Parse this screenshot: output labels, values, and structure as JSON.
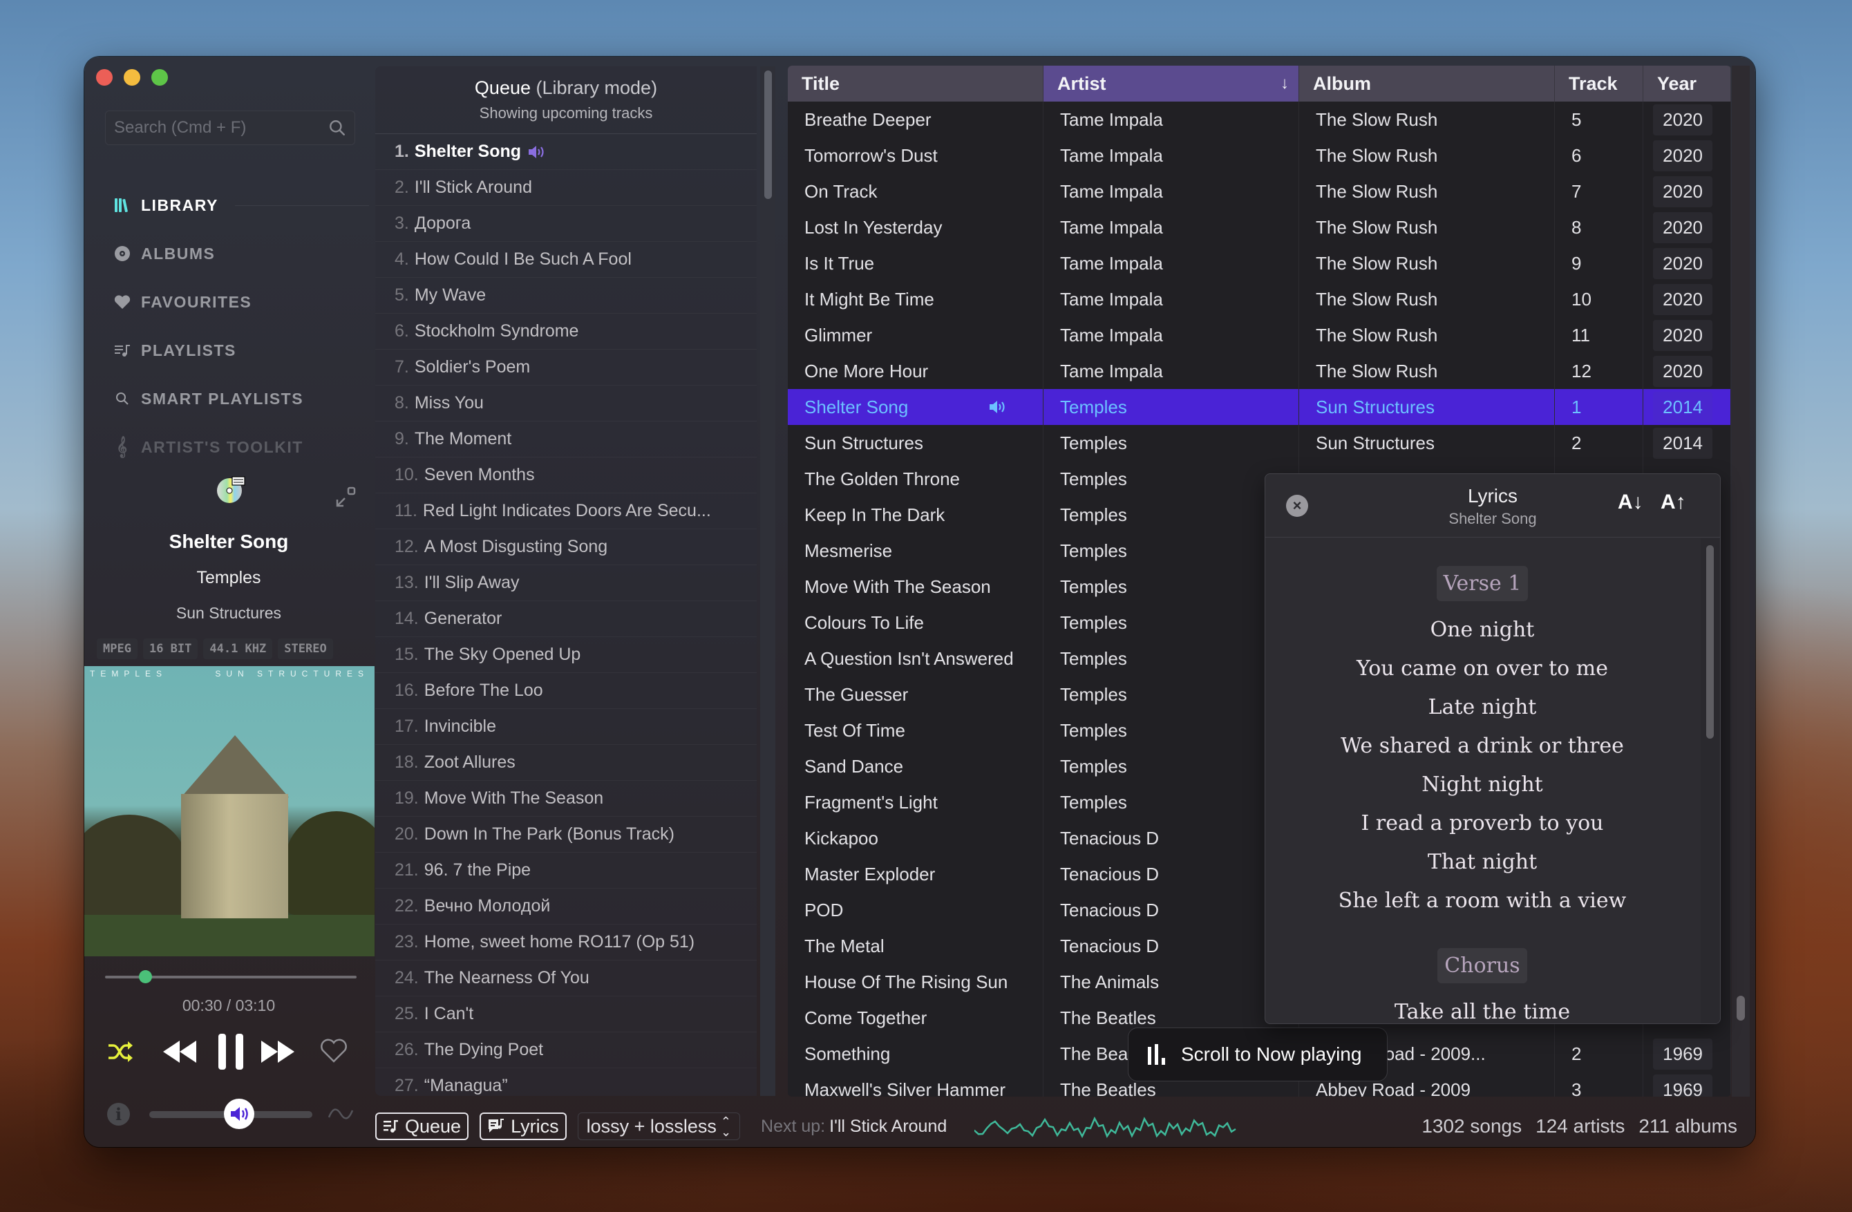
{
  "window": {
    "traffic_lights": [
      "close",
      "minimize",
      "zoom"
    ]
  },
  "sidebar": {
    "search_placeholder": "Search (Cmd + F)",
    "nav": [
      {
        "label": "LIBRARY",
        "icon": "library-icon",
        "state": "active"
      },
      {
        "label": "ALBUMS",
        "icon": "album-disc-icon",
        "state": "normal"
      },
      {
        "label": "FAVOURITES",
        "icon": "heart-icon",
        "state": "normal"
      },
      {
        "label": "PLAYLISTS",
        "icon": "playlist-icon",
        "state": "normal"
      },
      {
        "label": "SMART PLAYLISTS",
        "icon": "search-icon",
        "state": "normal"
      },
      {
        "label": "ARTIST'S TOOLKIT",
        "icon": "treble-clef-icon",
        "state": "dim"
      }
    ]
  },
  "now_playing": {
    "title": "Shelter Song",
    "artist": "Temples",
    "album": "Sun Structures",
    "badges": [
      "MPEG",
      "16 BIT",
      "44.1 KHZ",
      "STEREO"
    ],
    "cover_text_left": "TEMPLES",
    "cover_text_right": "SUN STRUCTURES",
    "elapsed": "00:30",
    "duration": "03:10",
    "time_display": "00:30 / 03:10",
    "progress_fraction": 0.158,
    "volume_fraction": 0.55,
    "shuffle_on": true,
    "is_playing": true
  },
  "queue": {
    "title": "Queue",
    "mode": "(Library mode)",
    "subtitle": "Showing upcoming tracks",
    "items": [
      {
        "n": "1.",
        "title": "Shelter Song",
        "current": true
      },
      {
        "n": "2.",
        "title": "I'll Stick Around"
      },
      {
        "n": "3.",
        "title": "Дорога"
      },
      {
        "n": "4.",
        "title": "How Could I Be Such A Fool"
      },
      {
        "n": "5.",
        "title": "My Wave"
      },
      {
        "n": "6.",
        "title": "Stockholm Syndrome"
      },
      {
        "n": "7.",
        "title": "Soldier's Poem"
      },
      {
        "n": "8.",
        "title": "Miss You"
      },
      {
        "n": "9.",
        "title": "The Moment"
      },
      {
        "n": "10.",
        "title": "Seven Months"
      },
      {
        "n": "11.",
        "title": "Red Light Indicates Doors Are Secu..."
      },
      {
        "n": "12.",
        "title": "A Most Disgusting Song"
      },
      {
        "n": "13.",
        "title": "I'll Slip Away"
      },
      {
        "n": "14.",
        "title": "Generator"
      },
      {
        "n": "15.",
        "title": "The Sky Opened Up"
      },
      {
        "n": "16.",
        "title": "Before The Loo"
      },
      {
        "n": "17.",
        "title": "Invincible"
      },
      {
        "n": "18.",
        "title": "Zoot Allures"
      },
      {
        "n": "19.",
        "title": "Move With The Season"
      },
      {
        "n": "20.",
        "title": "Down In The Park (Bonus Track)"
      },
      {
        "n": "21.",
        "title": "96. 7 the Pipe"
      },
      {
        "n": "22.",
        "title": "Вечно Молодой"
      },
      {
        "n": "23.",
        "title": "Home, sweet home RO117 (Op 51)"
      },
      {
        "n": "24.",
        "title": "The Nearness Of You"
      },
      {
        "n": "25.",
        "title": "I Can't"
      },
      {
        "n": "26.",
        "title": "The Dying Poet"
      },
      {
        "n": "27.",
        "title": "“Managua”"
      }
    ]
  },
  "library_table": {
    "columns": [
      {
        "key": "title",
        "label": "Title"
      },
      {
        "key": "artist",
        "label": "Artist",
        "sorted": "desc",
        "sort_indicator": "↓"
      },
      {
        "key": "album",
        "label": "Album"
      },
      {
        "key": "track",
        "label": "Track"
      },
      {
        "key": "year",
        "label": "Year"
      }
    ],
    "rows": [
      {
        "title": "Breathe Deeper",
        "artist": "Tame Impala",
        "album": "The Slow Rush",
        "track": "5",
        "year": "2020"
      },
      {
        "title": "Tomorrow's Dust",
        "artist": "Tame Impala",
        "album": "The Slow Rush",
        "track": "6",
        "year": "2020"
      },
      {
        "title": "On Track",
        "artist": "Tame Impala",
        "album": "The Slow Rush",
        "track": "7",
        "year": "2020"
      },
      {
        "title": "Lost In Yesterday",
        "artist": "Tame Impala",
        "album": "The Slow Rush",
        "track": "8",
        "year": "2020"
      },
      {
        "title": "Is It True",
        "artist": "Tame Impala",
        "album": "The Slow Rush",
        "track": "9",
        "year": "2020"
      },
      {
        "title": "It Might Be Time",
        "artist": "Tame Impala",
        "album": "The Slow Rush",
        "track": "10",
        "year": "2020"
      },
      {
        "title": "Glimmer",
        "artist": "Tame Impala",
        "album": "The Slow Rush",
        "track": "11",
        "year": "2020"
      },
      {
        "title": "One More Hour",
        "artist": "Tame Impala",
        "album": "The Slow Rush",
        "track": "12",
        "year": "2020"
      },
      {
        "title": "Shelter Song",
        "artist": "Temples",
        "album": "Sun Structures",
        "track": "1",
        "year": "2014",
        "playing": true
      },
      {
        "title": "Sun Structures",
        "artist": "Temples",
        "album": "Sun Structures",
        "track": "2",
        "year": "2014"
      },
      {
        "title": "The Golden Throne",
        "artist": "Temples",
        "album": "",
        "track": "",
        "year": ""
      },
      {
        "title": "Keep In The Dark",
        "artist": "Temples",
        "album": "",
        "track": "",
        "year": ""
      },
      {
        "title": "Mesmerise",
        "artist": "Temples",
        "album": "",
        "track": "",
        "year": ""
      },
      {
        "title": "Move With The Season",
        "artist": "Temples",
        "album": "",
        "track": "",
        "year": ""
      },
      {
        "title": "Colours To Life",
        "artist": "Temples",
        "album": "",
        "track": "",
        "year": ""
      },
      {
        "title": "A Question Isn't Answered",
        "artist": "Temples",
        "album": "",
        "track": "",
        "year": ""
      },
      {
        "title": "The Guesser",
        "artist": "Temples",
        "album": "",
        "track": "",
        "year": ""
      },
      {
        "title": "Test Of Time",
        "artist": "Temples",
        "album": "",
        "track": "",
        "year": ""
      },
      {
        "title": "Sand Dance",
        "artist": "Temples",
        "album": "",
        "track": "",
        "year": ""
      },
      {
        "title": "Fragment's Light",
        "artist": "Temples",
        "album": "",
        "track": "",
        "year": ""
      },
      {
        "title": "Kickapoo",
        "artist": "Tenacious D",
        "album": "",
        "track": "",
        "year": ""
      },
      {
        "title": "Master Exploder",
        "artist": "Tenacious D",
        "album": "",
        "track": "",
        "year": ""
      },
      {
        "title": "POD",
        "artist": "Tenacious D",
        "album": "",
        "track": "",
        "year": ""
      },
      {
        "title": "The Metal",
        "artist": "Tenacious D",
        "album": "",
        "track": "",
        "year": ""
      },
      {
        "title": "House Of The Rising Sun",
        "artist": "The Animals",
        "album": "",
        "track": "",
        "year": ""
      },
      {
        "title": "Come Together",
        "artist": "The Beatles",
        "album": "",
        "track": "",
        "year": ""
      },
      {
        "title": "Something",
        "artist": "The Beatles",
        "album": "Abbey Road - 2009...",
        "track": "2",
        "year": "1969"
      },
      {
        "title": "Maxwell's Silver Hammer",
        "artist": "The Beatles",
        "album": "Abbey Road - 2009",
        "track": "3",
        "year": "1969"
      }
    ]
  },
  "lyrics_panel": {
    "title": "Lyrics",
    "subtitle": "Shelter Song",
    "font_decrease_label": "A↓",
    "font_increase_label": "A↑",
    "close_label": "×",
    "sections": [
      {
        "label": "Verse 1",
        "lines": [
          "One night",
          "You came on over to me",
          "Late night",
          "We shared a drink or three",
          "Night night",
          "I read a proverb to you",
          "That night",
          "She left a room with a view"
        ]
      },
      {
        "label": "Chorus",
        "lines": [
          "Take all the time"
        ]
      }
    ]
  },
  "scroll_to_now_playing": {
    "label": "Scroll to Now playing"
  },
  "bottom_bar": {
    "queue_button": "Queue",
    "lyrics_button": "Lyrics",
    "format_select": "lossy + lossless",
    "next_up_label": "Next up:",
    "next_up_title": "I'll Stick Around",
    "stats": {
      "songs": "1302 songs",
      "artists": "124 artists",
      "albums": "211 albums"
    }
  },
  "colors": {
    "accent_purple": "#4a23d6",
    "sorted_header": "#5b4b8f",
    "playing_text": "#6cc0ff",
    "shuffle_active": "#e6f03c",
    "progress_knob": "#4bc079",
    "library_icon": "#5fe3e0",
    "waveform": "#3fb99a"
  }
}
